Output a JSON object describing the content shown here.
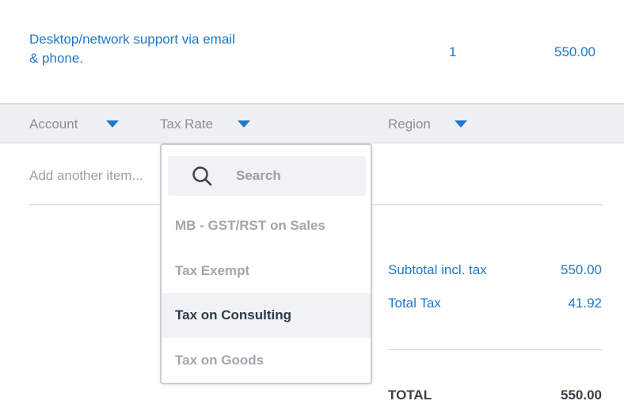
{
  "line_item": {
    "description": "Desktop/network support via email & phone.",
    "quantity": "1",
    "amount": "550.00"
  },
  "columns": {
    "account": "Account",
    "tax_rate": "Tax Rate",
    "region": "Region"
  },
  "add_item_placeholder": "Add another item...",
  "tax_dropdown": {
    "search_placeholder": "Search",
    "options": [
      "MB - GST/RST on Sales",
      "Tax Exempt",
      "Tax on Consulting",
      "Tax on Goods"
    ],
    "highlighted": "Tax on Consulting"
  },
  "totals": {
    "subtotal_label": "Subtotal incl. tax",
    "subtotal_value": "550.00",
    "total_tax_label": "Total Tax",
    "total_tax_value": "41.92",
    "total_label": "TOTAL",
    "total_value": "550.00"
  },
  "colors": {
    "accent": "#1f78c8",
    "header_bg": "#eef0f3"
  }
}
